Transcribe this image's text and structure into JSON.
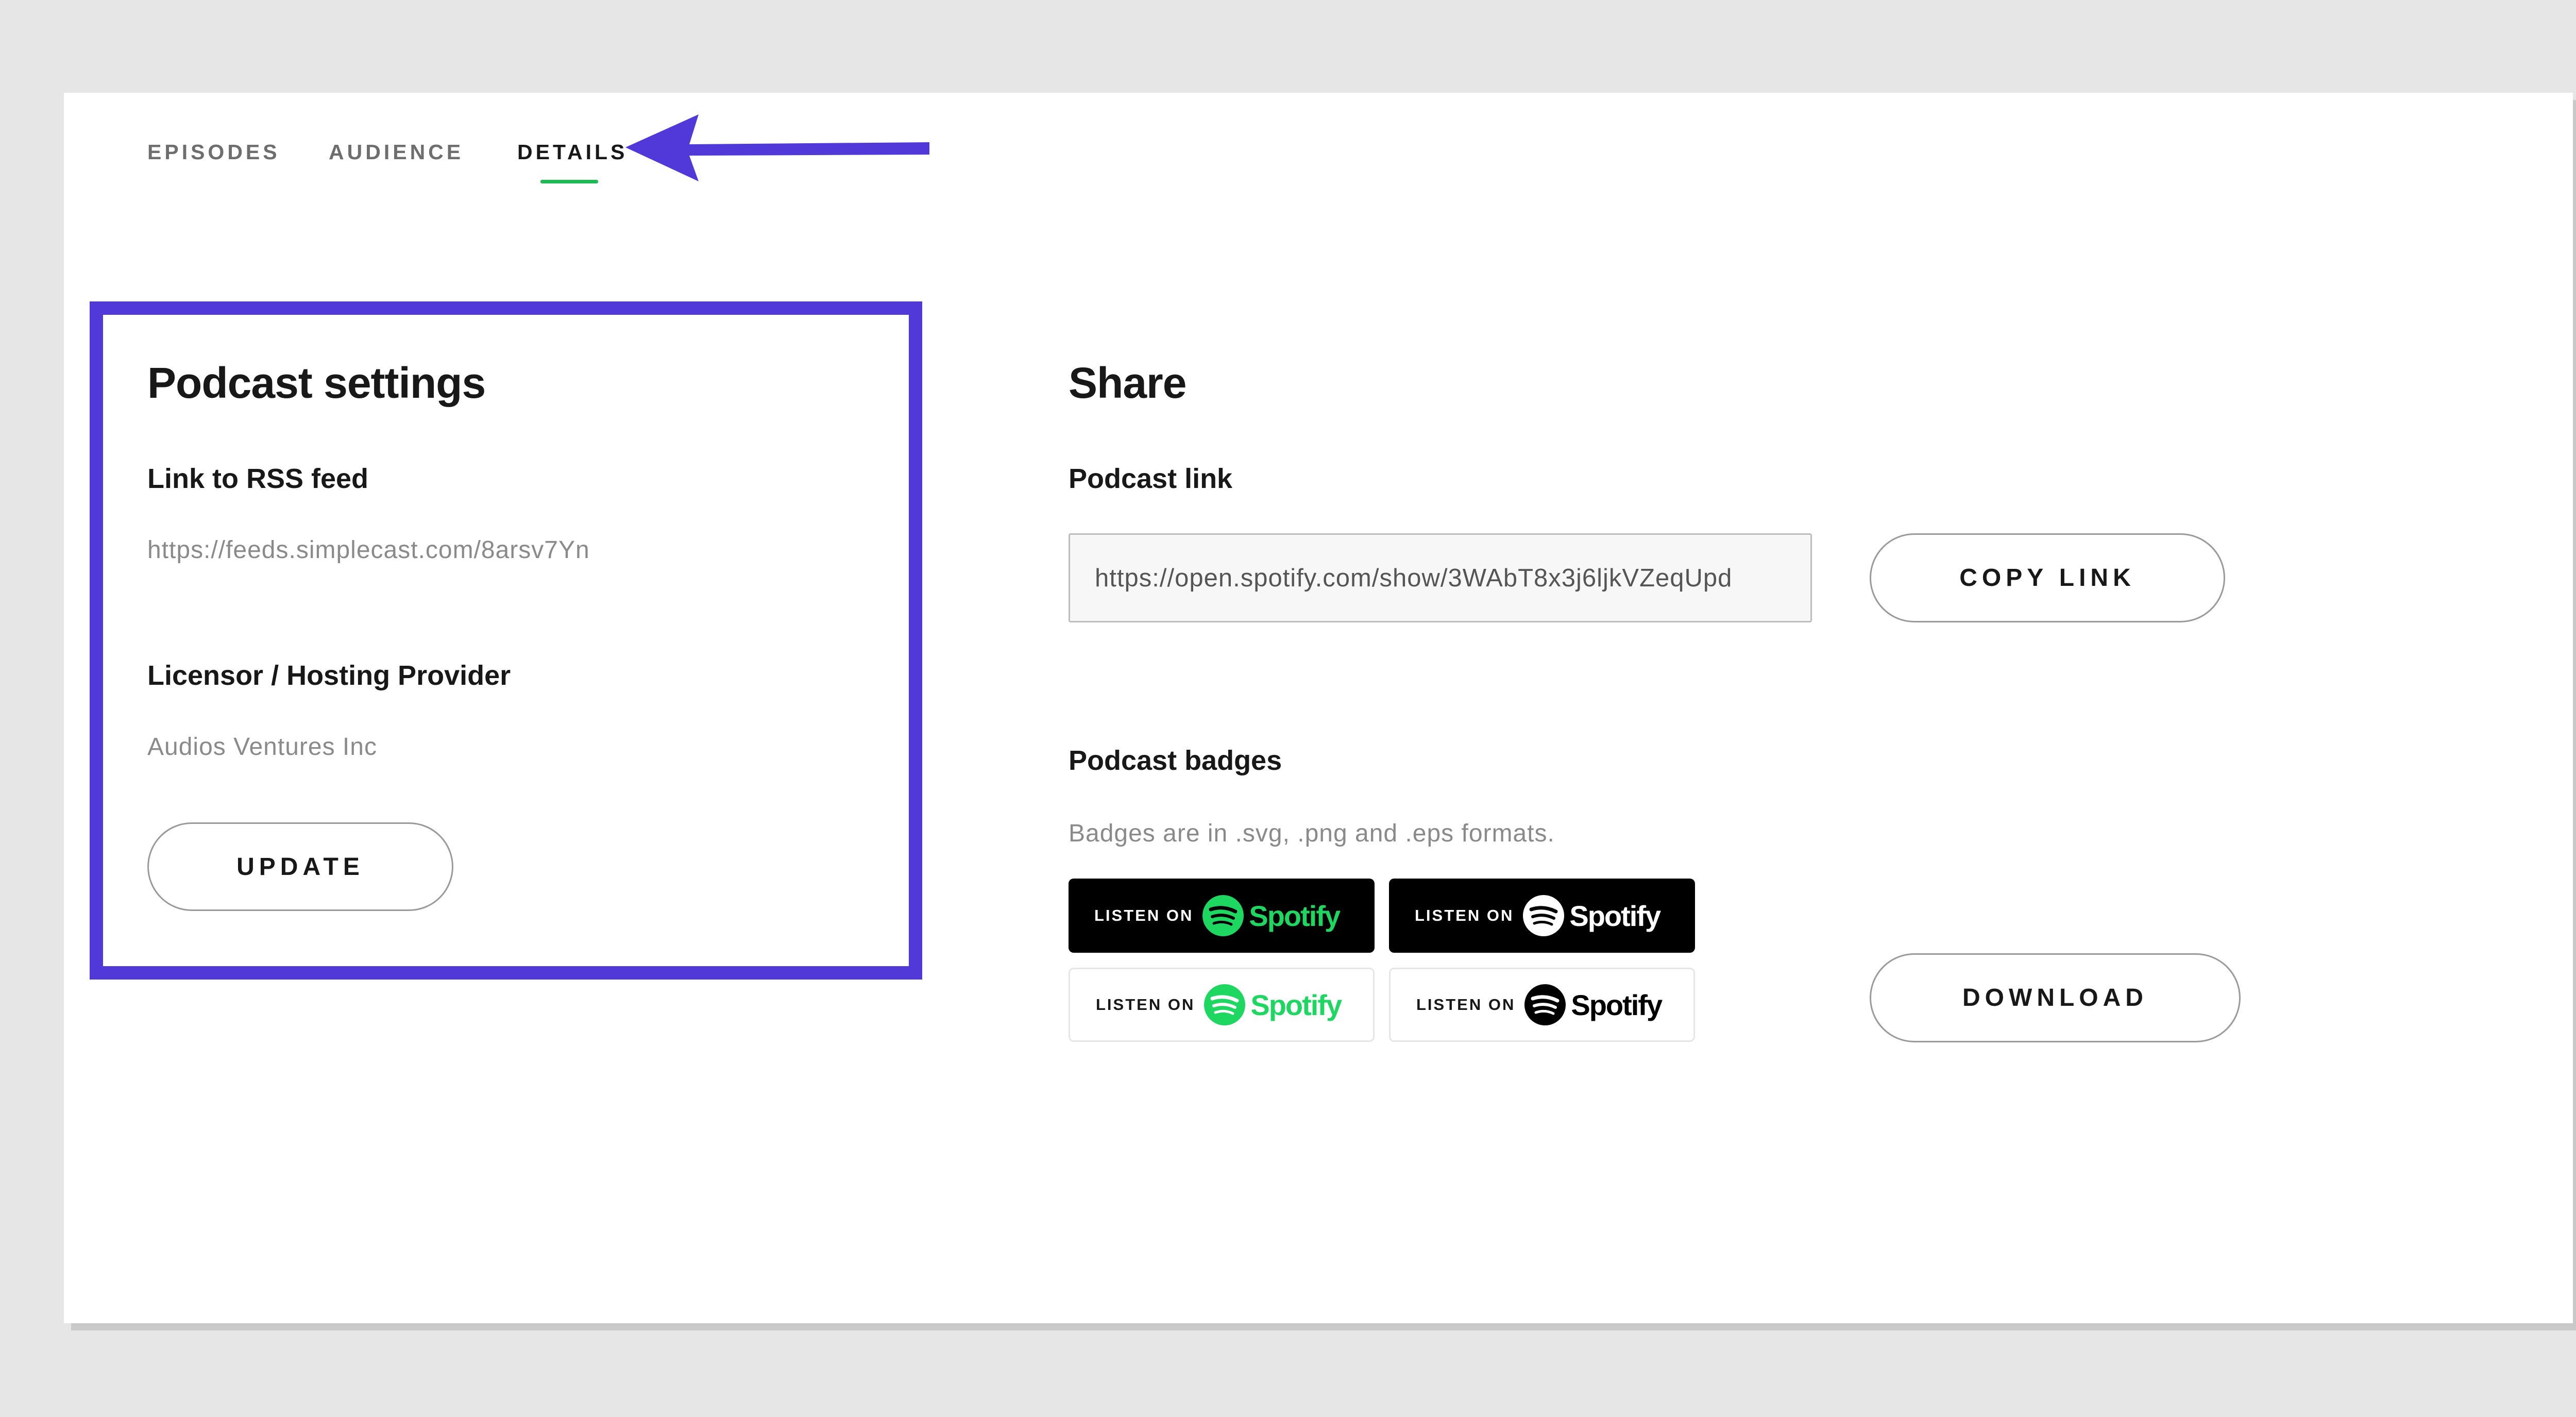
{
  "tabs": {
    "episodes": "EPISODES",
    "audience": "AUDIENCE",
    "details": "DETAILS"
  },
  "podcast_settings": {
    "title": "Podcast settings",
    "rss_label": "Link to RSS feed",
    "rss_value": "https://feeds.simplecast.com/8arsv7Yn",
    "licensor_label": "Licensor / Hosting Provider",
    "licensor_value": "Audios Ventures Inc",
    "update_button": "UPDATE"
  },
  "share": {
    "title": "Share",
    "podcast_link_label": "Podcast link",
    "podcast_link_value": "https://open.spotify.com/show/3WAbT8x3j6ljkVZeqUpd",
    "copy_link_button": "COPY LINK",
    "badges_label": "Podcast badges",
    "badges_note": "Badges are in .svg, .png and .eps formats.",
    "badge_listen_on": "LISTEN ON",
    "badge_wordmark": "Spotify",
    "download_button": "DOWNLOAD"
  },
  "colors": {
    "accent_highlight": "#5138d9",
    "spotify_green": "#1ed760",
    "tab_underline": "#1db954"
  },
  "icons": [
    "arrow-annotation-icon",
    "spotify-logo-icon"
  ]
}
